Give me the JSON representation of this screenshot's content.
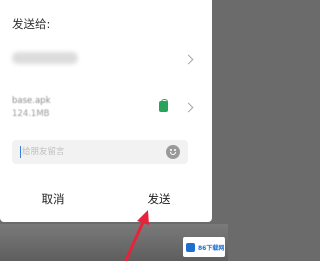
{
  "dialog": {
    "title": "发送给",
    "title_colon": ":",
    "recipient": {
      "name": ""
    },
    "file": {
      "name": "base.apk",
      "size": "124.1MB",
      "icon": "android-apk-icon",
      "icon_color": "#27a35a"
    },
    "message": {
      "placeholder": "给朋友留言",
      "value": ""
    },
    "cancel_label": "取消",
    "send_label": "发送"
  },
  "annotation": {
    "arrow_color": "#e8223a"
  },
  "watermark": {
    "text": "86下载网",
    "logo_color": "#1f6fd1"
  }
}
